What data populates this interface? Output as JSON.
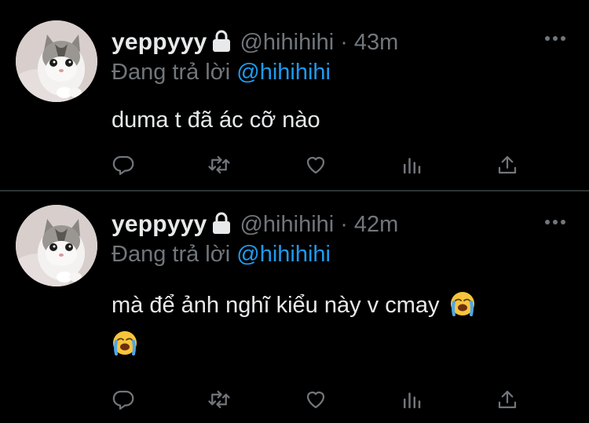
{
  "colors": {
    "background": "#000000",
    "primary_text": "#e7e9ea",
    "secondary_text": "#71767b",
    "mention": "#1d9bf0",
    "divider": "#2f3336"
  },
  "tweets": [
    {
      "display_name": "yeppyyy",
      "handle": "@hihihihi",
      "separator": "·",
      "time": "43m",
      "reply_prefix": "Đang trả lời",
      "reply_to": "@hihihihi",
      "text": "duma t đã ác cỡ nào",
      "icons": [
        "lock-icon",
        "more-icon",
        "reply-icon",
        "retweet-icon",
        "like-icon",
        "stats-icon",
        "share-icon"
      ]
    },
    {
      "display_name": "yeppyyy",
      "handle": "@hihihihi",
      "separator": "·",
      "time": "42m",
      "reply_prefix": "Đang trả lời",
      "reply_to": "@hihihihi",
      "text": "mà để ảnh nghĩ kiểu này v cmay",
      "emojis": [
        "loudly-crying-face",
        "loudly-crying-face"
      ],
      "icons": [
        "lock-icon",
        "more-icon",
        "reply-icon",
        "retweet-icon",
        "like-icon",
        "stats-icon",
        "share-icon"
      ]
    }
  ]
}
